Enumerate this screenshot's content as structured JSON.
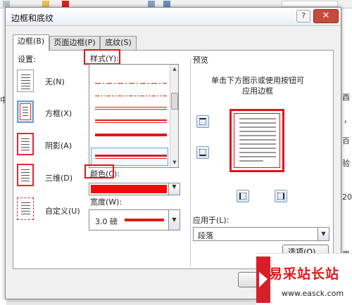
{
  "window": {
    "title": "边框和底纹",
    "help": "?",
    "close": "✕"
  },
  "tabs": [
    {
      "label": "边框(B)"
    },
    {
      "label": "页面边框(P)"
    },
    {
      "label": "底纹(S)"
    }
  ],
  "settings": {
    "label": "设置:",
    "items": [
      {
        "label": "无(N)"
      },
      {
        "label": "方框(X)"
      },
      {
        "label": "阴影(A)"
      },
      {
        "label": "三维(D)"
      },
      {
        "label": "自定义(U)"
      }
    ]
  },
  "style": {
    "label": "样式(Y):"
  },
  "color": {
    "label": "颜色(C):",
    "value_color": "#f50a0a"
  },
  "width": {
    "label": "宽度(W):",
    "value": "3.0 磅"
  },
  "preview": {
    "label": "预览",
    "hint_line1": "单击下方图示或使用按钮可",
    "hint_line2": "应用边框"
  },
  "apply_to": {
    "label": "应用于(L):",
    "value": "段落"
  },
  "buttons": {
    "options": "选项(O)...",
    "ok": "确"
  },
  "background_doc": {
    "chars": [
      "中",
      "酉",
      "，",
      "百",
      "验",
      "20",
      "果"
    ]
  },
  "watermark": {
    "title": "易采站长站",
    "url": "www.easck.com"
  },
  "colors": {
    "accent_red": "#e0141e",
    "selection_blue": "#6aa1d8"
  }
}
